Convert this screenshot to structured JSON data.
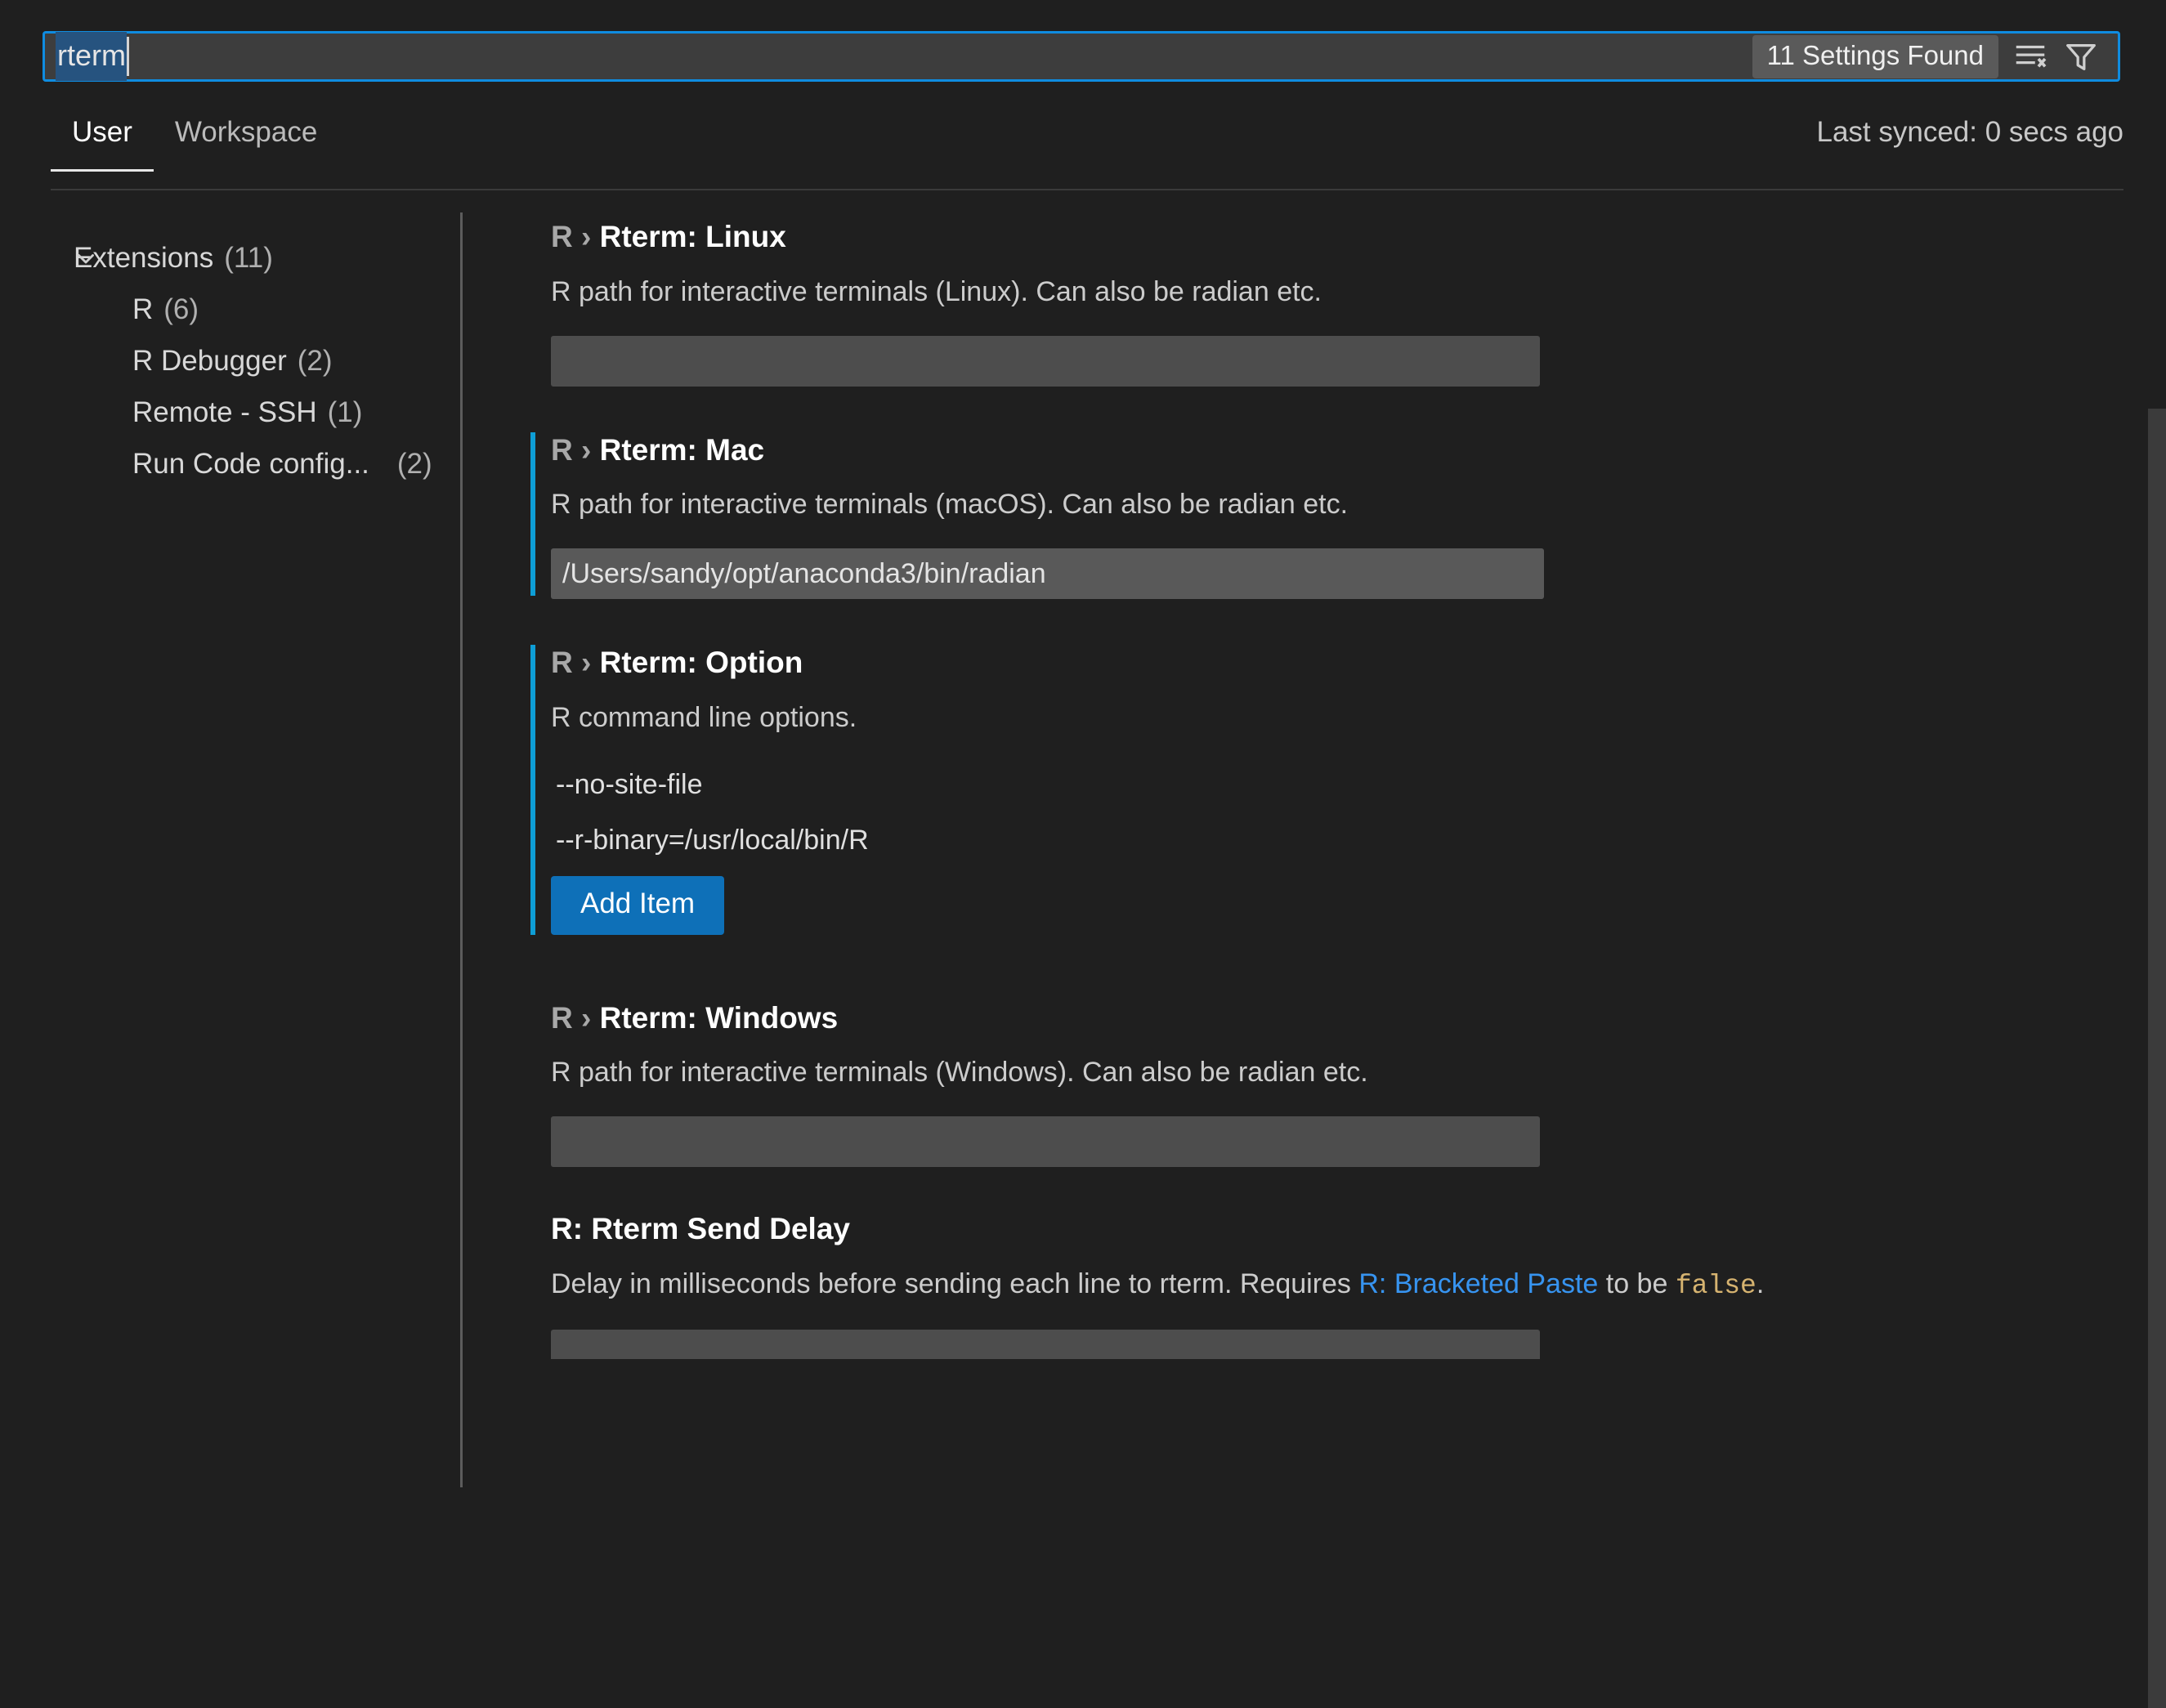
{
  "search": {
    "query": "rterm",
    "results_badge": "11 Settings Found",
    "clear_filter_icon": "clear-filter-icon",
    "filter_icon": "filter-funnel-icon"
  },
  "tabs": [
    {
      "label": "User",
      "active": true
    },
    {
      "label": "Workspace",
      "active": false
    }
  ],
  "sync_status": "Last synced: 0 secs ago",
  "toc": {
    "root": {
      "label": "Extensions",
      "count": "(11)",
      "expanded_icon": "chevron-down-icon"
    },
    "children": [
      {
        "label": "R",
        "count": "(6)"
      },
      {
        "label": "R Debugger",
        "count": "(2)"
      },
      {
        "label": "Remote - SSH",
        "count": "(1)"
      },
      {
        "label": "Run Code config...",
        "count": "(2)"
      }
    ]
  },
  "settings": [
    {
      "prefix": "R › ",
      "name": "Rterm: Linux",
      "description": "R path for interactive terminals (Linux). Can also be radian etc.",
      "value": "",
      "modified": false,
      "control": "text"
    },
    {
      "prefix": "R › ",
      "name": "Rterm: Mac",
      "description": "R path for interactive terminals (macOS). Can also be radian etc.",
      "value": "/Users/sandy/opt/anaconda3/bin/radian",
      "modified": true,
      "control": "text"
    },
    {
      "prefix": "R › ",
      "name": "Rterm: Option",
      "description": "R command line options.",
      "modified": true,
      "control": "list",
      "items": [
        "--no-site-file",
        "--r-binary=/usr/local/bin/R"
      ],
      "add_label": "Add Item"
    },
    {
      "prefix": "R › ",
      "name": "Rterm: Windows",
      "description": "R path for interactive terminals (Windows). Can also be radian etc.",
      "value": "",
      "modified": false,
      "control": "text"
    },
    {
      "prefix": "",
      "name": "R: Rterm Send Delay",
      "description_parts": {
        "before": "Delay in milliseconds before sending each line to rterm. Requires ",
        "link": "R: Bracketed Paste",
        "middle": " to be ",
        "code": "false",
        "after": "."
      },
      "modified": false,
      "control": "text-cut"
    }
  ],
  "colors": {
    "background": "#1f1f1f",
    "search_border": "#0f8ce0",
    "modified_bar": "#0e9ed6",
    "button_blue": "#0e70b8",
    "link_blue": "#3794f0",
    "code_tan": "#d6b370"
  }
}
